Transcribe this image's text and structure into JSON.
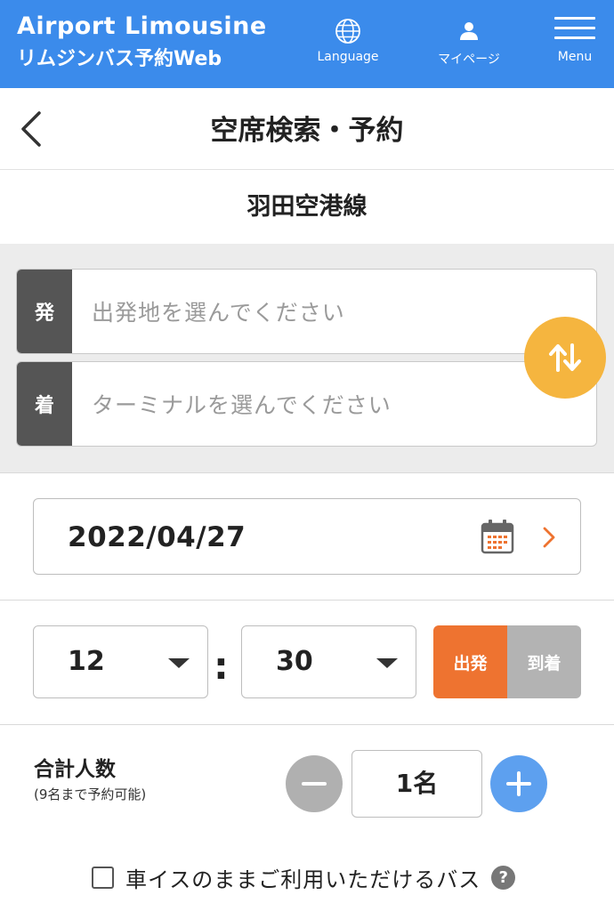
{
  "header": {
    "brand_title": "Airport Limousine",
    "brand_subtitle": "リムジンバス予約Web",
    "language_label": "Language",
    "mypage_label": "マイページ",
    "menu_label": "Menu",
    "bg_color": "#3b8beb"
  },
  "titlebar": {
    "title": "空席検索・予約",
    "back_icon": "chevron-left-icon"
  },
  "route": {
    "name": "羽田空港線"
  },
  "stops": {
    "from_tag": "発",
    "from_placeholder": "出発地を選んでください",
    "to_tag": "着",
    "to_placeholder": "ターミナルを選んでください",
    "swap_icon": "swap-arrows-icon",
    "swap_color": "#f5b53f"
  },
  "date": {
    "value": "2022/04/27",
    "calendar_icon": "calendar-icon"
  },
  "time": {
    "hour": "12",
    "separator": ":",
    "minute": "30",
    "depart_label": "出発",
    "arrive_label": "到着",
    "selected": "出発",
    "depart_color": "#ee7330"
  },
  "passengers": {
    "label": "合計人数",
    "note": "(9名まで予約可能)",
    "count": "1名"
  },
  "wheelchair": {
    "label": "車イスのままご利用いただけるバス",
    "checked": false,
    "help": "?"
  }
}
